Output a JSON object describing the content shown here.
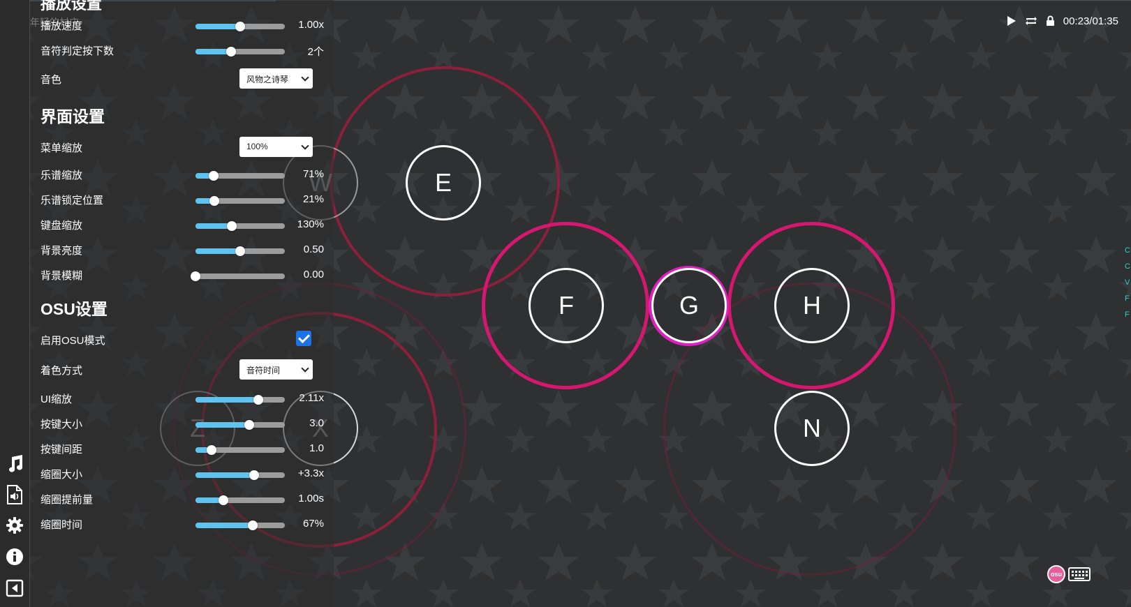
{
  "window": {
    "ghost_title": "不再年轻的村庄",
    "cut_section_title": "播放设置"
  },
  "top_controls": {
    "play_icon": "play-icon",
    "repeat_icon": "repeat-icon",
    "lock_icon": "lock-icon",
    "time": "00:23/01:35"
  },
  "sidebar_icons": [
    "music-note-icon",
    "audio-file-icon",
    "gear-icon",
    "info-icon",
    "collapse-panel-icon"
  ],
  "playback": {
    "speed": {
      "label": "播放速度",
      "value": "1.00x",
      "fraction": 0.5
    },
    "presses": {
      "label": "音符判定按下数",
      "value": "2个",
      "fraction": 0.4
    },
    "timbre": {
      "label": "音色",
      "selected": "风物之诗琴"
    }
  },
  "ui_settings": {
    "title": "界面设置",
    "menu_scale": {
      "label": "菜单缩放",
      "selected": "100%"
    },
    "score_scale": {
      "label": "乐谱缩放",
      "value": "71%",
      "fraction": 0.2
    },
    "score_lock": {
      "label": "乐谱锁定位置",
      "value": "21%",
      "fraction": 0.21
    },
    "keyboard_scale": {
      "label": "键盘缩放",
      "value": "130%",
      "fraction": 0.41
    },
    "bg_brightness": {
      "label": "背景亮度",
      "value": "0.50",
      "fraction": 0.5
    },
    "bg_blur": {
      "label": "背景模糊",
      "value": "0.00",
      "fraction": 0.0
    }
  },
  "osu_settings": {
    "title": "OSU设置",
    "enable": {
      "label": "启用OSU模式",
      "checked": true
    },
    "color_mode": {
      "label": "着色方式",
      "selected": "音符时间"
    },
    "ui_scale": {
      "label": "UI缩放",
      "value": "2.11x",
      "fraction": 0.7
    },
    "key_size": {
      "label": "按键大小",
      "value": "3.0",
      "fraction": 0.6
    },
    "key_spacing": {
      "label": "按键间距",
      "value": "1.0",
      "fraction": 0.18
    },
    "ring_size": {
      "label": "缩圈大小",
      "value": "+3.3x",
      "fraction": 0.66
    },
    "ring_advance": {
      "label": "缩圈提前量",
      "value": "1.00s",
      "fraction": 0.31
    },
    "ring_time": {
      "label": "缩圈时间",
      "value": "67%",
      "fraction": 0.64
    }
  },
  "keys": [
    "W",
    "E",
    "F",
    "G",
    "H",
    "Z",
    "X",
    "N"
  ],
  "colors": {
    "accent_blue": "#5ec4ef",
    "ring_pink": "#d4176f",
    "ring_magenta": "#e01fc0",
    "ring_dark_red": "#8c1f3c",
    "checkbox": "#1a73e8"
  },
  "bottom": {
    "osu_badge": "osu",
    "keyboard_icon": "keyboard-icon"
  },
  "edge_chars": [
    "C",
    "C",
    "V",
    "F",
    "F"
  ]
}
